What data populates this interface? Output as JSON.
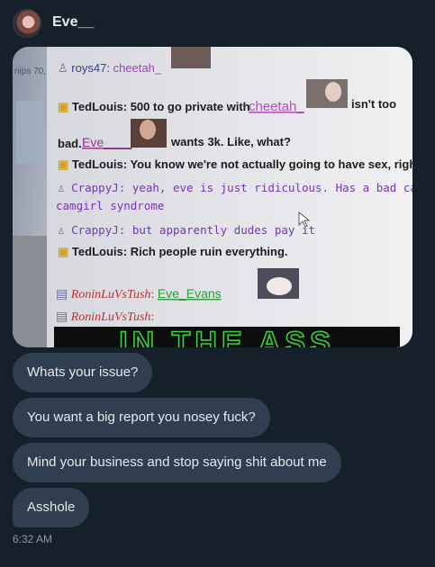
{
  "conversation": {
    "contact_name": "Eve__",
    "timestamp": "6:32 AM"
  },
  "screenshot": {
    "left_fragment": "nips 70,",
    "lines": [
      {
        "user": "roys47",
        "sep": ":",
        "text": "cheetah_"
      },
      {
        "user": "TedLouis",
        "sep": ":",
        "text": "500 to go private with"
      },
      {
        "mention": "cheetah_",
        "text": "isn't too"
      },
      {
        "text": "bad.",
        "mention": "Eve____",
        "tail": "wants 3k. Like, what?"
      },
      {
        "user": "TedLouis",
        "sep": ":",
        "text": "You know we're not actually going to have sex, right"
      },
      {
        "user": "CrappyJ",
        "sep": ":",
        "text": "yeah, eve is just ridiculous. Has a bad case o"
      },
      {
        "text": "camgirl syndrome"
      },
      {
        "user": "CrappyJ",
        "sep": ":",
        "text": "but apparently dudes pay it"
      },
      {
        "user": "TedLouis",
        "sep": ":",
        "text": "Rich people ruin everything."
      },
      {
        "user": "RoninLuVsTush",
        "sep": ":",
        "text": "Eve_Evans"
      },
      {
        "user": "RoninLuVsTush",
        "sep": ":"
      }
    ],
    "banner_text": "IN THE ASS"
  },
  "messages": [
    {
      "text": "Whats your issue?"
    },
    {
      "text": "You want a big report you nosey fuck?"
    },
    {
      "text": "Mind your business and stop saying shit about me"
    },
    {
      "text": "Asshole"
    }
  ]
}
